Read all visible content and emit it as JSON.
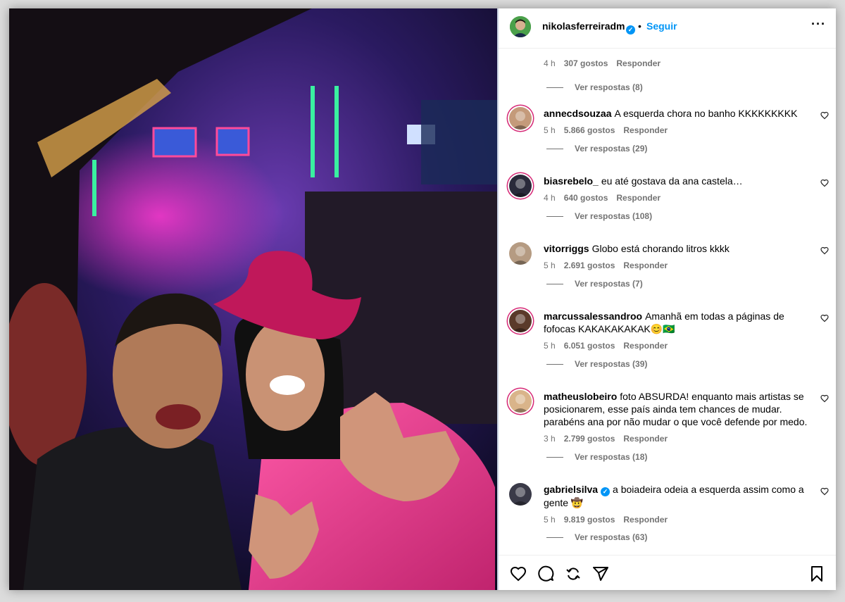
{
  "post": {
    "username": "nikolasferreiradm",
    "dot": "•",
    "follow_label": "Seguir",
    "more_icon": "more-horizontal-icon",
    "verified_mark": "✓"
  },
  "top_reply": {
    "time": "4 h",
    "likes": "307 gostos",
    "reply": "Responder",
    "view_replies": "Ver respostas (8)"
  },
  "comments": [
    {
      "username": "annecdsouzaa",
      "text": "A esquerda chora no banho KKKKKKKKK",
      "time": "5 h",
      "likes": "5.866 gostos",
      "reply": "Responder",
      "view_replies": "Ver respostas (29)",
      "verified": false,
      "story": true,
      "avatar_color": "#c49a7a"
    },
    {
      "username": "biasrebelo_",
      "text": "eu até gostava da ana castela…",
      "time": "4 h",
      "likes": "640 gostos",
      "reply": "Responder",
      "view_replies": "Ver respostas (108)",
      "verified": false,
      "story": true,
      "avatar_color": "#2a2a3a"
    },
    {
      "username": "vitorriggs",
      "text": "Globo está chorando litros kkkk",
      "time": "5 h",
      "likes": "2.691 gostos",
      "reply": "Responder",
      "view_replies": "Ver respostas (7)",
      "verified": false,
      "story": false,
      "avatar_color": "#b59b82"
    },
    {
      "username": "marcussalessandroo",
      "text": "Amanhã em todas a páginas de fofocas KAKAKAKAKAK😊🇧🇷",
      "time": "5 h",
      "likes": "6.051 gostos",
      "reply": "Responder",
      "view_replies": "Ver respostas (39)",
      "verified": false,
      "story": true,
      "avatar_color": "#5a3a2a"
    },
    {
      "username": "matheuslobeiro",
      "text": "foto ABSURDA! enquanto mais artistas se posicionarem, esse país ainda tem chances de mudar. parabéns ana por não mudar o que você defende por medo.",
      "time": "3 h",
      "likes": "2.799 gostos",
      "reply": "Responder",
      "view_replies": "Ver respostas (18)",
      "verified": false,
      "story": true,
      "avatar_color": "#d9b48a"
    },
    {
      "username": "gabrielsilva",
      "text": "a boiadeira odeia a esquerda assim como a gente 🤠",
      "time": "5 h",
      "likes": "9.819 gostos",
      "reply": "Responder",
      "view_replies": "Ver respostas (63)",
      "verified": true,
      "story": false,
      "avatar_color": "#3a3a48"
    }
  ],
  "actions": [
    "heart-icon",
    "comment-icon",
    "repost-icon",
    "share-icon",
    "bookmark-icon"
  ]
}
